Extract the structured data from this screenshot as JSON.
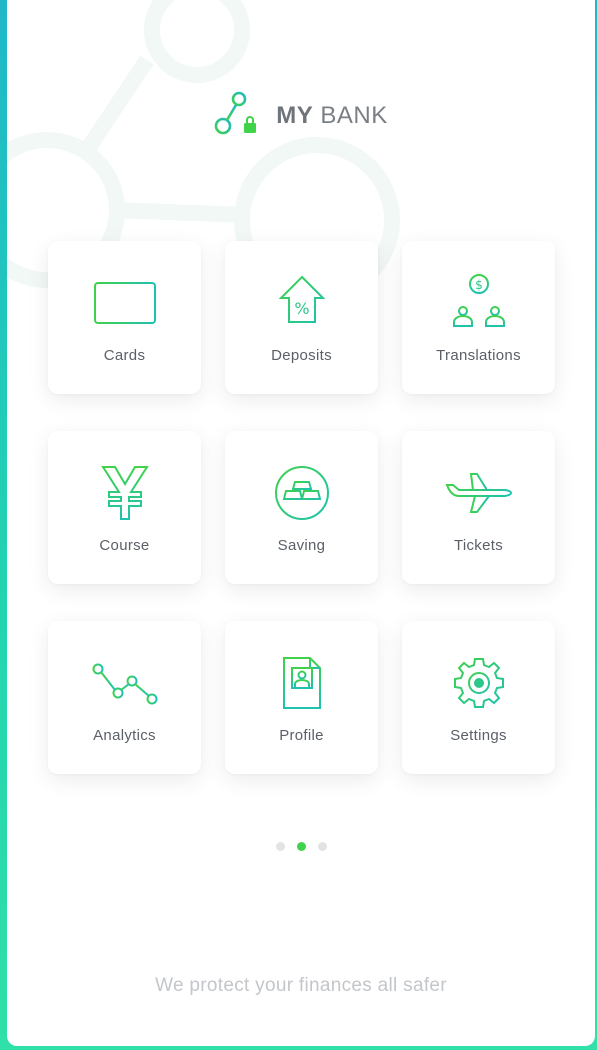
{
  "brand": {
    "name_bold": "MY",
    "name_rest": " BANK"
  },
  "tiles": [
    {
      "label": "Cards",
      "icon": "credit-card-icon"
    },
    {
      "label": "Deposits",
      "icon": "house-percent-icon"
    },
    {
      "label": "Translations",
      "icon": "money-transfer-icon"
    },
    {
      "label": "Course",
      "icon": "yen-icon"
    },
    {
      "label": "Saving",
      "icon": "gold-bars-icon"
    },
    {
      "label": "Tickets",
      "icon": "airplane-icon"
    },
    {
      "label": "Analytics",
      "icon": "line-chart-icon"
    },
    {
      "label": "Profile",
      "icon": "profile-document-icon"
    },
    {
      "label": "Settings",
      "icon": "gear-icon"
    }
  ],
  "pagination": {
    "pages": 3,
    "active": 2
  },
  "footer": {
    "text": "We protect your finances all safer"
  },
  "colors": {
    "accent_green": "#3fd24a",
    "accent_teal": "#1fb8c9"
  }
}
